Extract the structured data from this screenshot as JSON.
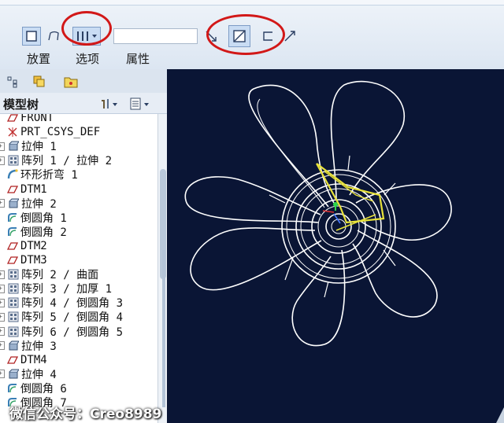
{
  "ribbon": {
    "tabs": [
      "放置",
      "选项",
      "属性"
    ],
    "thickness_value": ""
  },
  "left_panel": {
    "tabs": [
      "model-tree-tab",
      "layer-tab",
      "folder-tab"
    ],
    "header_title": "模型树"
  },
  "tree": {
    "items": [
      {
        "label": "FRONT",
        "icon": "datum-plane"
      },
      {
        "label": "PRT_CSYS_DEF",
        "icon": "csys"
      },
      {
        "label": "拉伸 1",
        "icon": "extrude"
      },
      {
        "label": "阵列 1 / 拉伸 2",
        "icon": "pattern"
      },
      {
        "label": "环形折弯 1",
        "icon": "toroidal-bend"
      },
      {
        "label": "DTM1",
        "icon": "datum-plane"
      },
      {
        "label": "拉伸 2",
        "icon": "extrude"
      },
      {
        "label": "倒圆角 1",
        "icon": "round"
      },
      {
        "label": "倒圆角 2",
        "icon": "round"
      },
      {
        "label": "DTM2",
        "icon": "datum-plane"
      },
      {
        "label": "DTM3",
        "icon": "datum-plane"
      },
      {
        "label": "阵列 2 / 曲面",
        "icon": "pattern"
      },
      {
        "label": "阵列 3 / 加厚 1",
        "icon": "pattern"
      },
      {
        "label": "阵列 4 / 倒圆角 3",
        "icon": "pattern"
      },
      {
        "label": "阵列 5 / 倒圆角 4",
        "icon": "pattern"
      },
      {
        "label": "阵列 6 / 倒圆角 5",
        "icon": "pattern"
      },
      {
        "label": "拉伸 3",
        "icon": "extrude"
      },
      {
        "label": "DTM4",
        "icon": "datum-plane"
      },
      {
        "label": "拉伸 4",
        "icon": "extrude"
      },
      {
        "label": "倒圆角 6",
        "icon": "round"
      },
      {
        "label": "倒圆角 7",
        "icon": "round"
      }
    ]
  },
  "watermark": "微信公众号：Creo8989",
  "colors": {
    "viewport_bg": "#0a1535",
    "highlight": "#e8e23a",
    "annotation_red": "#d21818",
    "ribbon_bg": "#e6edf6"
  }
}
